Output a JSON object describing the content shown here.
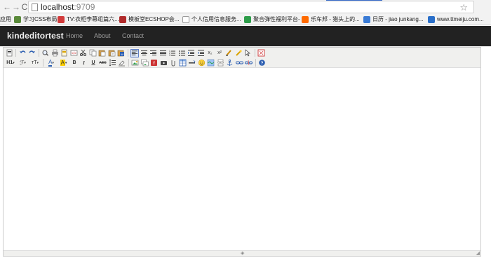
{
  "browser": {
    "url_host": "localhost",
    "url_port": ":9709",
    "back_icon": "back-arrow-icon",
    "forward_icon": "forward-arrow-icon",
    "reload_icon": "reload-icon",
    "star_icon": "bookmark-star-icon",
    "back_glyph": "←",
    "forward_glyph": "→",
    "reload_glyph": "C",
    "star_glyph": "☆"
  },
  "bookmarks": [
    {
      "label": "应用",
      "color": "#4a7fd4"
    },
    {
      "label": "学习CSS布局",
      "color": "#5a8a3a"
    },
    {
      "label": "TV:衣柜李幕组篇六...",
      "color": "#d23a3a"
    },
    {
      "label": "模板堂ECSHOP会...",
      "color": "#b02a2a"
    },
    {
      "label": "个人信用信息服务...",
      "color": "#ffffff"
    },
    {
      "label": "聚合弹性福利平台-",
      "color": "#2e9d4a"
    },
    {
      "label": "乐车邦 - 猎头上的...",
      "color": "#ff6a00"
    },
    {
      "label": "日历 - jiao junkang...",
      "color": "#3a7bd5"
    },
    {
      "label": "www.ttmeiju.com...",
      "color": "#2a6fc9"
    }
  ],
  "navbar": {
    "brand": "kindeditortest",
    "links": [
      "Home",
      "About",
      "Contact"
    ]
  },
  "toolbar": {
    "row1": [
      "source-icon",
      "sep",
      "undo-icon",
      "redo-icon",
      "sep",
      "preview-icon",
      "print-icon",
      "template-icon",
      "code-icon",
      "cut-icon",
      "copy-icon",
      "paste-icon",
      "paste-plain-icon",
      "paste-word-icon",
      "sep",
      "align-left-icon",
      "align-center-icon",
      "align-right-icon",
      "align-justify-icon",
      "ordered-list-icon",
      "unordered-list-icon",
      "indent-icon",
      "outdent-icon",
      "subscript-icon",
      "superscript-icon",
      "clear-html-icon",
      "quick-format-icon",
      "select-all-icon",
      "sep",
      "fullscreen-icon"
    ],
    "row2": [
      "heading-icon",
      "font-family-icon",
      "font-size-icon",
      "sep",
      "font-color-icon",
      "highlight-color-icon",
      "bold-icon",
      "italic-icon",
      "underline-icon",
      "strikethrough-icon",
      "line-height-icon",
      "remove-format-icon",
      "sep",
      "image-icon",
      "multi-image-icon",
      "flash-icon",
      "media-icon",
      "insert-file-icon",
      "table-icon",
      "horizontal-rule-icon",
      "emoticons-icon",
      "baidu-map-icon",
      "page-break-icon",
      "anchor-icon",
      "link-icon",
      "unlink-icon",
      "sep",
      "about-icon"
    ],
    "labels": {
      "h1": "H1",
      "font": "ℱ",
      "size": "тT",
      "color": "A",
      "bold": "B",
      "italic": "I",
      "underline": "U",
      "strike": "ABC",
      "sub": "x₂",
      "sup": "x²",
      "caret": "▾"
    }
  },
  "editor": {
    "content": "",
    "resize_glyph": "◈",
    "grip_glyph": "◢"
  },
  "colors": {
    "navbar_bg": "#222222",
    "brand_text": "#eeeeee",
    "nav_link": "#9d9d9d",
    "toolbar_bg": "#f0f0ee",
    "editor_border": "#cccccc"
  }
}
